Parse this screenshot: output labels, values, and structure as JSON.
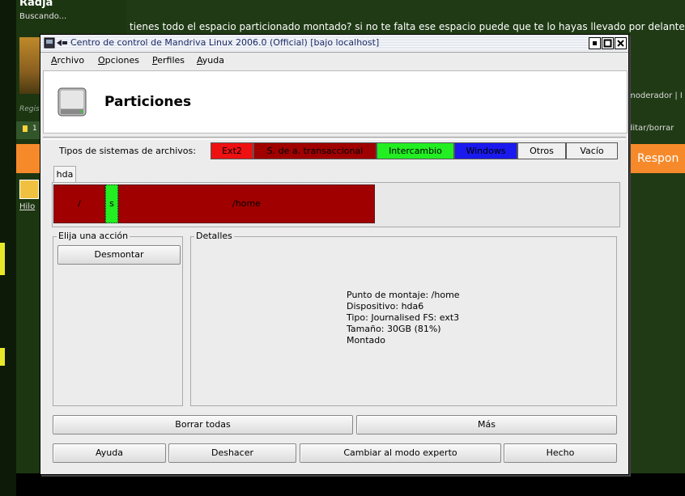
{
  "background": {
    "username": "Radja",
    "user_status": "Buscando...",
    "registered_label": "Regis",
    "row_label": "1",
    "thread_link": "Hilo",
    "post_text": "tienes todo el espacio particionado montado? si no te falta ese espacio puede que te lo hayas llevado por delante",
    "moderator_link": "moderador | I",
    "edit_link": "ditar/borrar",
    "reply_button": "Respon"
  },
  "window": {
    "title": "Centro de control de Mandriva Linux 2006.0 (Official) [bajo localhost]",
    "menu": [
      {
        "label": "Archivo",
        "mnemonic": "A",
        "rest": "rchivo"
      },
      {
        "label": "Opciones",
        "mnemonic": "O",
        "rest": "pciones"
      },
      {
        "label": "Perfiles",
        "mnemonic": "P",
        "rest": "erfiles"
      },
      {
        "label": "Ayuda",
        "mnemonic": "A",
        "rest": "yuda"
      }
    ],
    "header_title": "Particiones",
    "icon_names": {
      "app": "mandriva-icon",
      "disk": "hard-disk-icon"
    }
  },
  "filesystems": {
    "label": "Tipos de sistemas de archivos:",
    "types": [
      {
        "label": "Ext2",
        "color": "#ee1111",
        "text_color": "#000000"
      },
      {
        "label": "S. de a. transaccional",
        "color": "#a00000",
        "text_color": "#000000"
      },
      {
        "label": "Intercambio",
        "color": "#22ee22",
        "text_color": "#000000"
      },
      {
        "label": "Windows",
        "color": "#1a1aee",
        "text_color": "#000000"
      },
      {
        "label": "Otros",
        "color": "#f0f0f0",
        "text_color": "#000000"
      },
      {
        "label": "Vacío",
        "color": "#f0f0f0",
        "text_color": "#000000"
      }
    ]
  },
  "disk": {
    "tab": "hda",
    "partitions": [
      {
        "label": "/",
        "color": "#a00000"
      },
      {
        "label": "s",
        "color": "#22ee22"
      },
      {
        "label": "/home",
        "color": "#a00000"
      }
    ]
  },
  "actions": {
    "group_title": "Elija una acción",
    "unmount_button": "Desmontar"
  },
  "details": {
    "group_title": "Detalles",
    "mount_point": "Punto de montaje: /home",
    "device": "Dispositivo: hda6",
    "type": "Tipo: Journalised FS: ext3",
    "size": "Tamaño: 30GB (81%)",
    "state": "Montado"
  },
  "buttons": {
    "clear_all": "Borrar todas",
    "more": "Más",
    "help": "Ayuda",
    "undo": "Deshacer",
    "expert_mode": "Cambiar al modo experto",
    "done": "Hecho"
  }
}
